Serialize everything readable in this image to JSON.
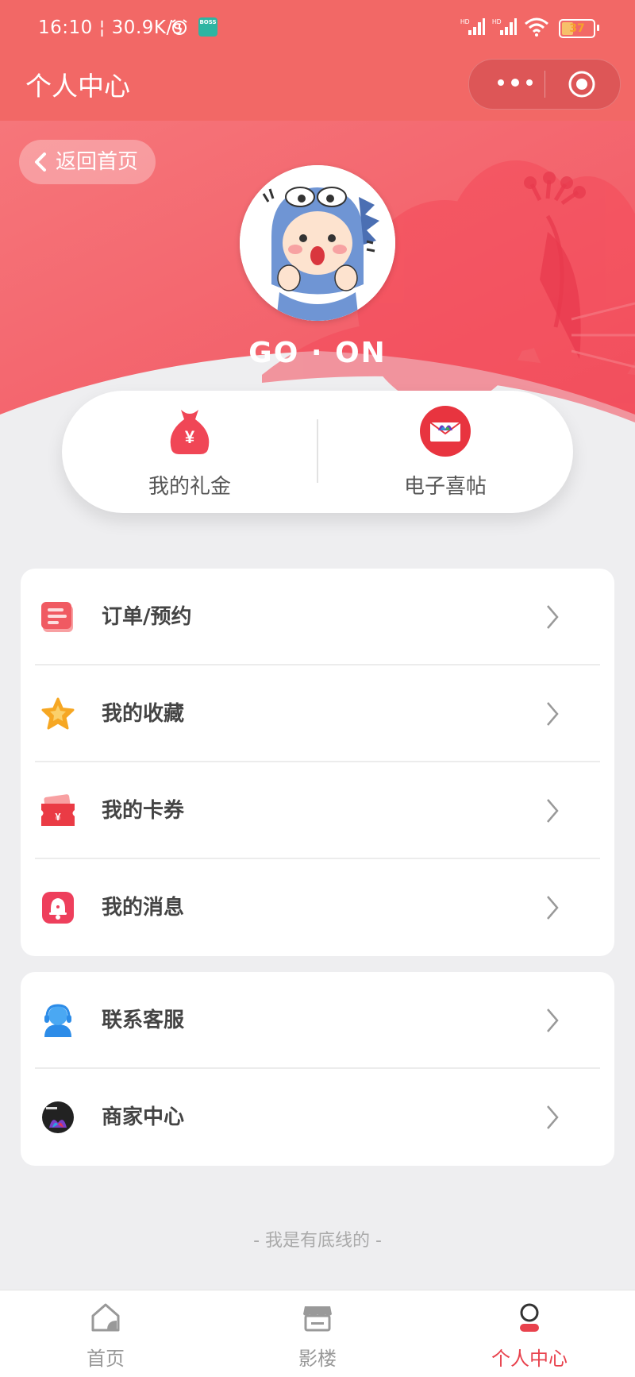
{
  "status_bar": {
    "time": "16:10",
    "speed": "30.9K/s",
    "battery": "37"
  },
  "header": {
    "title": "个人中心"
  },
  "banner": {
    "back_label": "返回首页",
    "username": "GO · ON"
  },
  "quick_actions": [
    {
      "label": "我的礼金",
      "icon": "money-bag-icon"
    },
    {
      "label": "电子喜帖",
      "icon": "invitation-icon"
    }
  ],
  "menu_group_1": [
    {
      "label": "订单/预约",
      "icon": "order-icon"
    },
    {
      "label": "我的收藏",
      "icon": "star-icon"
    },
    {
      "label": "我的卡券",
      "icon": "coupon-icon"
    },
    {
      "label": "我的消息",
      "icon": "bell-icon"
    }
  ],
  "menu_group_2": [
    {
      "label": "联系客服",
      "icon": "customer-service-icon"
    },
    {
      "label": "商家中心",
      "icon": "merchant-logo-icon"
    }
  ],
  "footer_note": "- 我是有底线的 -",
  "tabbar": [
    {
      "label": "首页",
      "icon": "home-icon",
      "active": false
    },
    {
      "label": "影楼",
      "icon": "shop-icon",
      "active": false
    },
    {
      "label": "个人中心",
      "icon": "profile-icon",
      "active": true
    }
  ],
  "colors": {
    "primary": "#f26866",
    "accent_red": "#e8424d",
    "background": "#eeeef0"
  }
}
